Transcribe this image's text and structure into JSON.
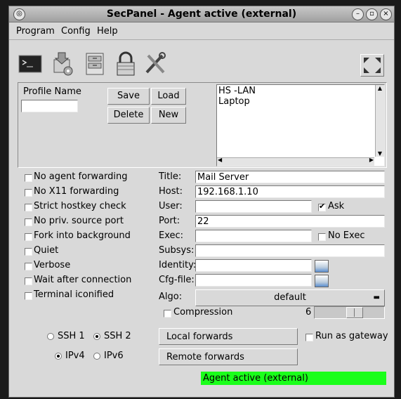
{
  "window": {
    "title": "SecPanel - Agent active (external)"
  },
  "menu": {
    "items": [
      "Program",
      "Config",
      "Help"
    ]
  },
  "toolbar": {
    "icons": [
      "terminal-icon",
      "sftp-icon",
      "filer-icon",
      "lock-icon",
      "tools-icon",
      "fullscreen-icon"
    ]
  },
  "profile": {
    "label": "Profile Name",
    "name_value": "",
    "save": "Save",
    "load": "Load",
    "delete": "Delete",
    "new": "New",
    "list": [
      "HS -LAN",
      "Laptop"
    ]
  },
  "options": [
    {
      "label": "No agent forwarding",
      "checked": false
    },
    {
      "label": "No X11 forwarding",
      "checked": false
    },
    {
      "label": "Strict hostkey check",
      "checked": false
    },
    {
      "label": "No priv. source port",
      "checked": false
    },
    {
      "label": "Fork into background",
      "checked": false
    },
    {
      "label": "Quiet",
      "checked": false
    },
    {
      "label": "Verbose",
      "checked": false
    },
    {
      "label": "Wait after connection",
      "checked": false
    },
    {
      "label": "Terminal iconified",
      "checked": false
    }
  ],
  "fields": {
    "title": {
      "label": "Title:",
      "value": "Mail Server"
    },
    "host": {
      "label": "Host:",
      "value": "192.168.1.10"
    },
    "user": {
      "label": "User:",
      "value": ""
    },
    "ask": {
      "label": "Ask",
      "checked": true
    },
    "port": {
      "label": "Port:",
      "value": "22"
    },
    "exec": {
      "label": "Exec:",
      "value": ""
    },
    "noexec": {
      "label": "No Exec",
      "checked": false
    },
    "subsys": {
      "label": "Subsys:",
      "value": ""
    },
    "identity": {
      "label": "Identity:",
      "value": ""
    },
    "cfgfile": {
      "label": "Cfg-file:",
      "value": ""
    },
    "algo": {
      "label": "Algo:",
      "value": "default"
    },
    "compression": {
      "label": "Compression",
      "checked": false,
      "level": "6",
      "level_fraction": 0.6
    }
  },
  "ssh": {
    "ssh1": "SSH 1",
    "ssh2": "SSH 2",
    "selected": "SSH 2"
  },
  "ip": {
    "ipv4": "IPv4",
    "ipv6": "IPv6",
    "selected": "IPv4"
  },
  "forwards": {
    "local": "Local forwards",
    "remote": "Remote forwards",
    "gateway": "Run as gateway",
    "gateway_checked": false
  },
  "status": {
    "text": "Agent active (external)",
    "color": "#1aff1a"
  }
}
